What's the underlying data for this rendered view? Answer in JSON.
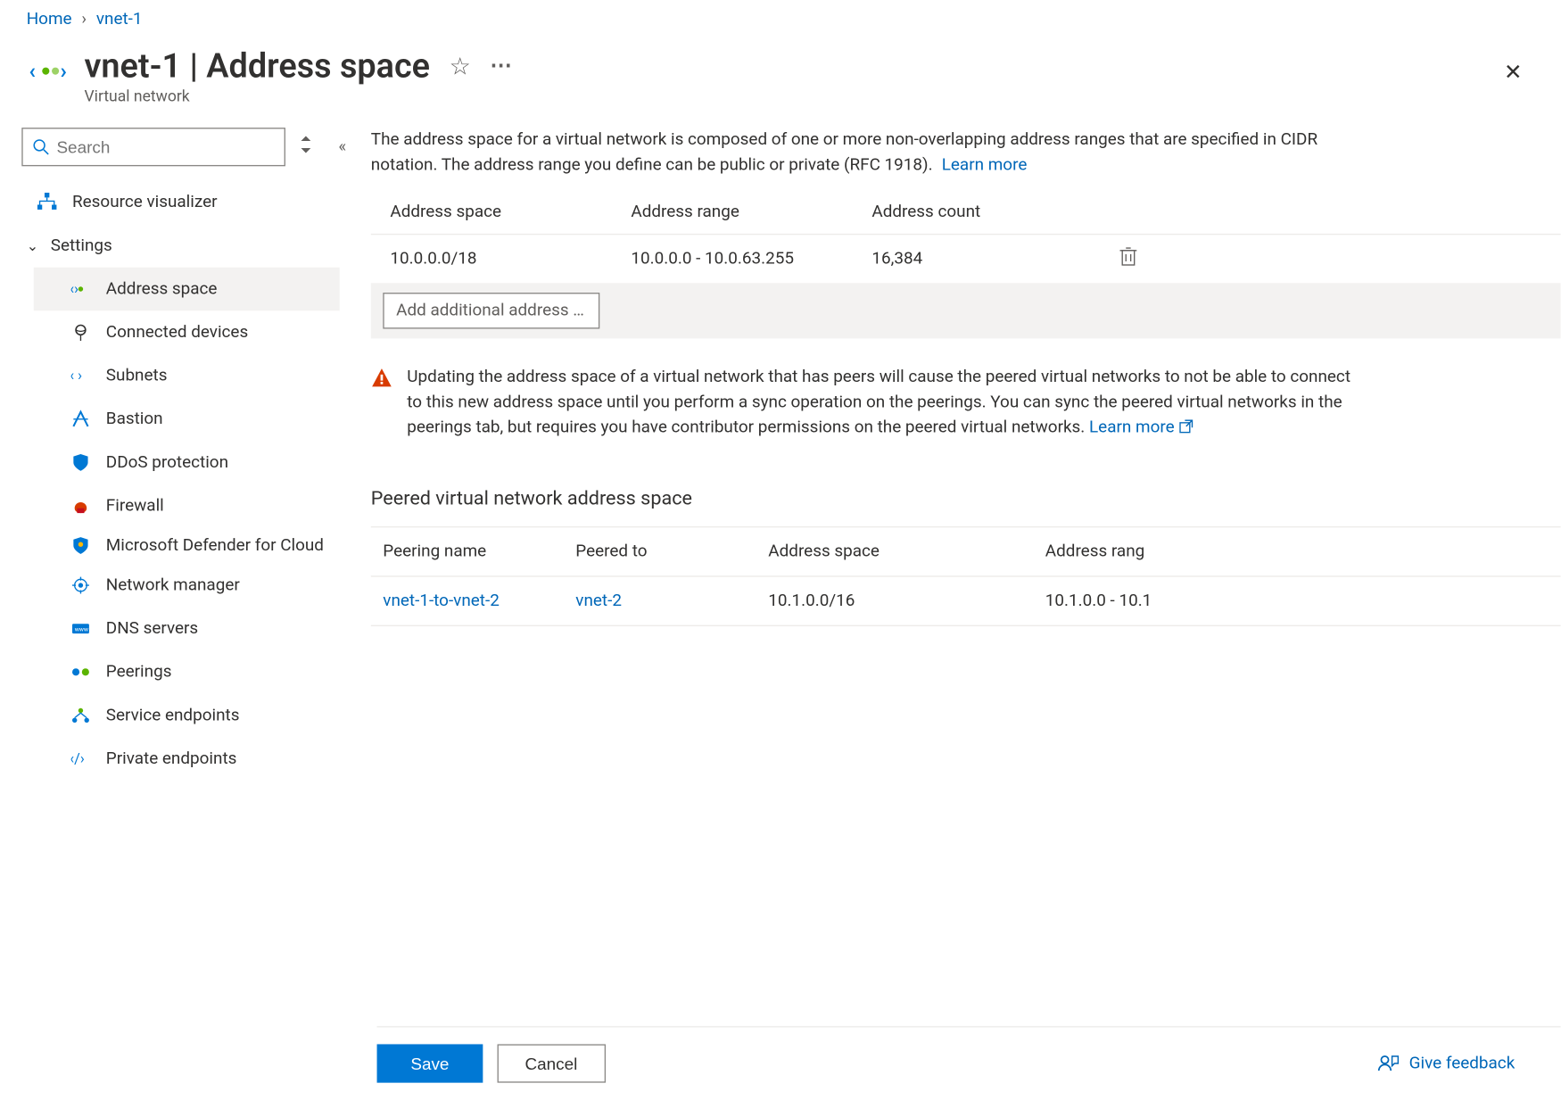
{
  "breadcrumb": {
    "home": "Home",
    "current": "vnet-1"
  },
  "header": {
    "title": "vnet-1 | Address space",
    "subtype": "Virtual network"
  },
  "search": {
    "placeholder": "Search"
  },
  "nav": {
    "resource_visualizer": "Resource visualizer",
    "settings_group": "Settings",
    "address_space": "Address space",
    "connected_devices": "Connected devices",
    "subnets": "Subnets",
    "bastion": "Bastion",
    "ddos": "DDoS protection",
    "firewall": "Firewall",
    "defender": "Microsoft Defender for Cloud",
    "network_manager": "Network manager",
    "dns_servers": "DNS servers",
    "peerings": "Peerings",
    "service_endpoints": "Service endpoints",
    "private_endpoints": "Private endpoints"
  },
  "description": {
    "text": "The address space for a virtual network is composed of one or more non-overlapping address ranges that are specified in CIDR notation. The address range you define can be public or private (RFC 1918).",
    "learn_more": "Learn more"
  },
  "address_table": {
    "headers": {
      "space": "Address space",
      "range": "Address range",
      "count": "Address count"
    },
    "rows": [
      {
        "space": "10.0.0.0/18",
        "range": "10.0.0.0 - 10.0.63.255",
        "count": "16,384"
      }
    ],
    "add_placeholder": "Add additional address r…"
  },
  "warning": {
    "text": "Updating the address space of a virtual network that has peers will cause the peered virtual networks to not be able to connect to this new address space until you perform a sync operation on the peerings. You can sync the peered virtual networks in the peerings tab, but requires you have contributor permissions on the peered virtual networks.",
    "learn_more": "Learn more"
  },
  "peered": {
    "title": "Peered virtual network address space",
    "headers": {
      "name": "Peering name",
      "to": "Peered to",
      "space": "Address space",
      "range": "Address rang"
    },
    "rows": [
      {
        "name": "vnet-1-to-vnet-2",
        "to": "vnet-2",
        "space": "10.1.0.0/16",
        "range": "10.1.0.0 - 10.1"
      }
    ]
  },
  "footer": {
    "save": "Save",
    "cancel": "Cancel",
    "feedback": "Give feedback"
  }
}
